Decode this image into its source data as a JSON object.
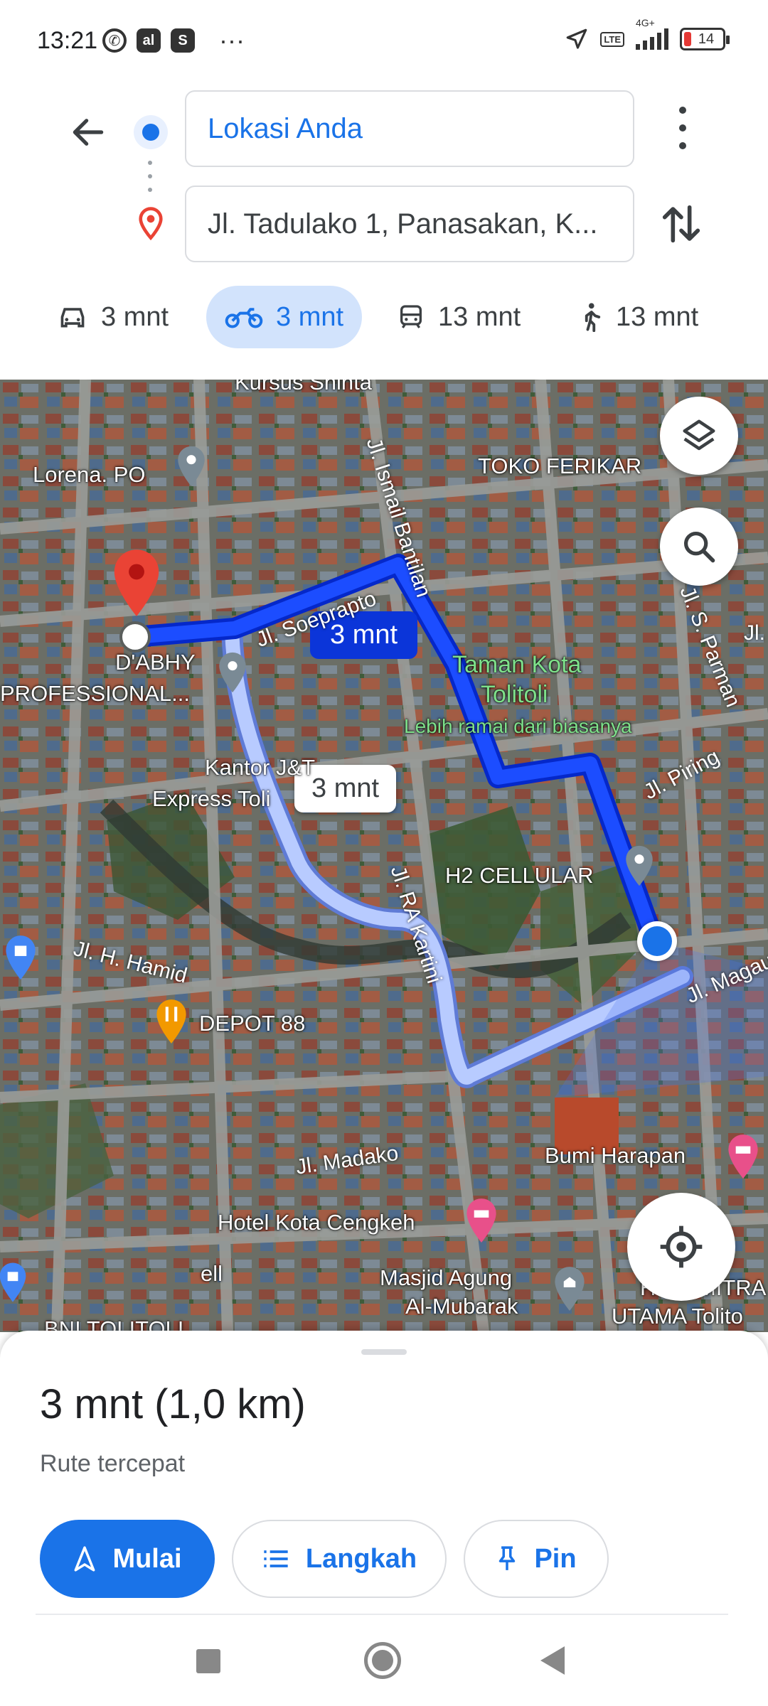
{
  "status_bar": {
    "time": "13:21",
    "left_icons": [
      "whatsapp-icon",
      "app-icon",
      "shop-icon"
    ],
    "more": "···",
    "lte_badge": "LTE",
    "network": "4G+",
    "battery": "14"
  },
  "directions": {
    "origin": "Lokasi Anda",
    "destination": "Jl. Tadulako 1, Panasakan, K...",
    "modes": [
      {
        "name": "car",
        "label": "3 mnt",
        "active": false
      },
      {
        "name": "motorcycle",
        "label": "3 mnt",
        "active": true
      },
      {
        "name": "transit",
        "label": "13 mnt",
        "active": false
      },
      {
        "name": "walk",
        "label": "13 mnt",
        "active": false
      }
    ]
  },
  "map": {
    "route_bubble_primary": "3 mnt",
    "route_bubble_alt": "3 mnt",
    "places": {
      "lorena": "Lorena. PO",
      "toko": "TOKO FERIKAR",
      "dabhy_1": "D'ABHY",
      "dabhy_2": "PROFESSIONAL...",
      "taman_1": "Taman Kota",
      "taman_2": "Tolitoli",
      "taman_busy": "Lebih ramai dari biasanya",
      "kantor_1": "Kantor J&T",
      "kantor_2": "Express Toli",
      "h2": "H2 CELLULAR",
      "depot": "DEPOT 88",
      "bumi": "Bumi Harapan",
      "hotel": "Hotel Kota Cengkeh",
      "masjid_1": "Masjid Agung",
      "masjid_2": "Al-Mubarak",
      "hotel_mitra_1": "Hotel MITRA",
      "hotel_mitra_2": "UTAMA Tolito",
      "bni": "BNI TOLITOLI",
      "kursus": "Kursus Shinta",
      "ell": "ell"
    },
    "roads": {
      "soeprapto": "Jl. Soeprapto",
      "ismail": "Jl. Ismail Bantilan",
      "sparman": "Jl. S. Parman",
      "piring": "Jl. Piring",
      "kartini": "Jl. RA Kartini",
      "hamid": "Jl. H. Hamid",
      "magau": "Jl. Magau",
      "madako": "Jl. Madako",
      "jl": "Jl."
    }
  },
  "sheet": {
    "summary": "3 mnt (1,0 km)",
    "subtitle": "Rute tercepat",
    "start_label": "Mulai",
    "steps_label": "Langkah",
    "pin_label": "Pin"
  },
  "colors": {
    "accent": "#1a73e8",
    "route_primary": "#0b3df5",
    "route_alt": "#a8c1ff",
    "pin_red": "#ea4335"
  }
}
